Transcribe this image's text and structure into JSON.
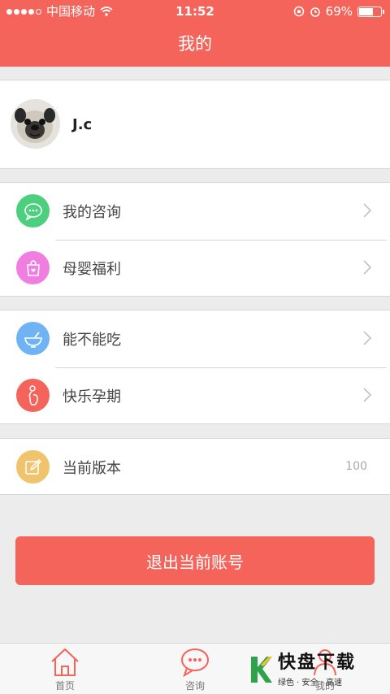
{
  "status_bar": {
    "carrier": "中国移动",
    "time": "11:52",
    "battery": "69%",
    "battery_level": 0.69
  },
  "header": {
    "title": "我的"
  },
  "profile": {
    "username": "J.c"
  },
  "menu": {
    "consult": {
      "label": "我的咨询",
      "color": "#4cd07d"
    },
    "welfare": {
      "label": "母婴福利",
      "color": "#f07de0"
    },
    "can_eat": {
      "label": "能不能吃",
      "color": "#6fb3f5"
    },
    "pregnancy": {
      "label": "快乐孕期",
      "color": "#f4645a"
    },
    "version": {
      "label": "当前版本",
      "value": "100",
      "color": "#f0c36d"
    }
  },
  "logout_label": "退出当前账号",
  "tabs": {
    "home": {
      "label": "首页",
      "icon": "home-icon"
    },
    "consult": {
      "label": "咨询",
      "icon": "chat-icon"
    },
    "mine": {
      "label": "我的",
      "icon": "person-icon"
    }
  },
  "watermark": {
    "text": "快盘下载",
    "sub": "绿色 · 安全 · 高速"
  },
  "colors": {
    "brand": "#f4645a"
  }
}
